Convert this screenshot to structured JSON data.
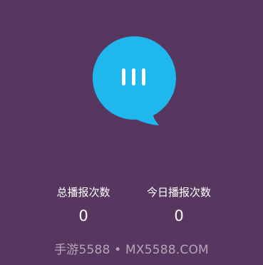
{
  "voice_button": {
    "icon": "voice-bars-icon",
    "color": "#1fb8ec"
  },
  "stats": {
    "total_label": "总播报次数",
    "total_value": "0",
    "today_label": "今日播报次数",
    "today_value": "0"
  },
  "watermark": "手游5588 • MX5588.COM",
  "colors": {
    "background": "#57375f",
    "accent": "#1fb8ec",
    "text": "#ffffff"
  }
}
